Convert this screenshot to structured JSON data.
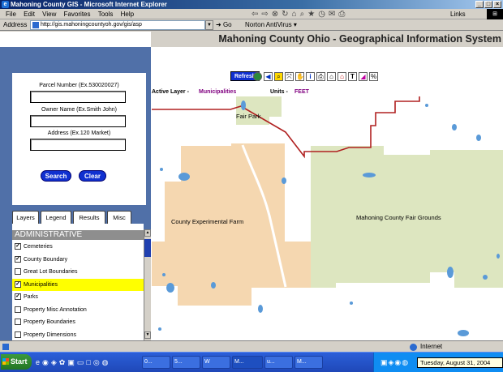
{
  "window": {
    "title": "Mahoning County GIS - Microsoft Internet Explorer",
    "min": "_",
    "max": "□",
    "close": "×"
  },
  "menu": [
    "File",
    "Edit",
    "View",
    "Favorites",
    "Tools",
    "Help"
  ],
  "links_label": "Links",
  "address": {
    "label": "Address",
    "url": "http://gis.mahoningcountyoh.gov/gis/asp",
    "go": "Go",
    "norton": "Norton AntiVirus"
  },
  "app": {
    "title": "Mahoning County Ohio - Geographical Information System"
  },
  "search": {
    "parcel_label": "Parcel Number (Ex.530020027)",
    "parcel_value": "",
    "owner_label": "Owner Name (Ex.Smith John)",
    "owner_value": "",
    "address_label": "Address (Ex.120 Market)",
    "address_value": "",
    "search_btn": "Search",
    "clear_btn": "Clear"
  },
  "tabs": [
    "Layers",
    "Legend",
    "Results",
    "Misc"
  ],
  "layers": {
    "group": "ADMINISTRATIVE",
    "items": [
      {
        "label": "Cemeteries",
        "checked": true,
        "highlight": false
      },
      {
        "label": "County Boundary",
        "checked": true,
        "highlight": false
      },
      {
        "label": "Great Lot Boundaries",
        "checked": false,
        "highlight": false
      },
      {
        "label": "Municipalities",
        "checked": true,
        "highlight": true
      },
      {
        "label": "Parks",
        "checked": true,
        "highlight": false
      },
      {
        "label": "Property Misc Annotation",
        "checked": false,
        "highlight": false
      },
      {
        "label": "Property Boundaries",
        "checked": false,
        "highlight": false
      },
      {
        "label": "Property Dimensions",
        "checked": false,
        "highlight": false
      }
    ]
  },
  "map_toolbar": {
    "refresh": "Refresh",
    "tools": [
      "globe-icon",
      "back-arrow-icon",
      "zoom-in-icon",
      "zoom-extent-icon",
      "pan-hand-icon",
      "info-icon",
      "print-icon",
      "measure-icon",
      "buffer-icon",
      "text-icon",
      "eraser-icon",
      "percent-icon"
    ]
  },
  "layer_info": {
    "active_label": "Active Layer -",
    "active_value": "Municipalities",
    "units_label": "Units -",
    "units_value": "FEET"
  },
  "map": {
    "labels": {
      "fair_park": "Fair Park",
      "experimental_farm": "County Experimental Farm",
      "fair_grounds": "Mahoning County Fair Grounds"
    },
    "colors": {
      "land": "#f5d7b0",
      "park": "#dde6c0",
      "water": "#5a9ad8",
      "boundary": "#b02020"
    }
  },
  "status": {
    "zone": "Internet"
  },
  "taskbar": {
    "start": "Start",
    "tasks": [
      "0...",
      "5...",
      "W",
      "M...",
      "u...",
      "M..."
    ],
    "tooltip": "Tuesday, August 31, 2004"
  }
}
